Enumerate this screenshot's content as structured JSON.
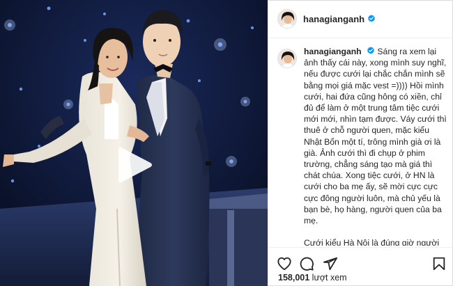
{
  "post": {
    "username": "hanagianganh",
    "verified_icon": "verified-badge-icon",
    "brand_blue": "#0095f6"
  },
  "caption": {
    "username": "hanagianganh",
    "para1": "Sáng ra xem lại ảnh thấy cái này, xong mình suy nghĩ, nếu được cưới lại chắc chắn mình sẽ bằng mọi giá mặc vest =)))) Hồi mình cưới, hai đứa cũng hông có xiền, chỉ đủ để làm ở một trung tâm tiệc cưới mới mới, nhìn tạm được. Váy cưới thì thuê ở chỗ người quen, mặc kiểu Nhật Bổn một tí, trông mình già ơi là già. Ảnh cưới thì đi chụp ở phim trường, chẳng sáng tạo mà giá thì chát chúa. Xong tiệc cưới, ở HN là cưới cho ba mẹ ấy, sẽ mời cực cực cực đông người luôn, mà chủ yếu là bạn bè, họ hàng, người quen của ba mẹ.",
    "para2": "Cưới kiểu Hà Nội là đúng giờ người ta đến ăn thật nhanh, vèo vèo rồi đứng lên đi về. Nhiều người còn chẳng biết"
  },
  "actions": {
    "like_icon": "heart-icon",
    "comment_icon": "comment-icon",
    "share_icon": "send-icon",
    "save_icon": "bookmark-icon"
  },
  "stats": {
    "views_count": "158,001",
    "views_label": "lượt xem"
  }
}
